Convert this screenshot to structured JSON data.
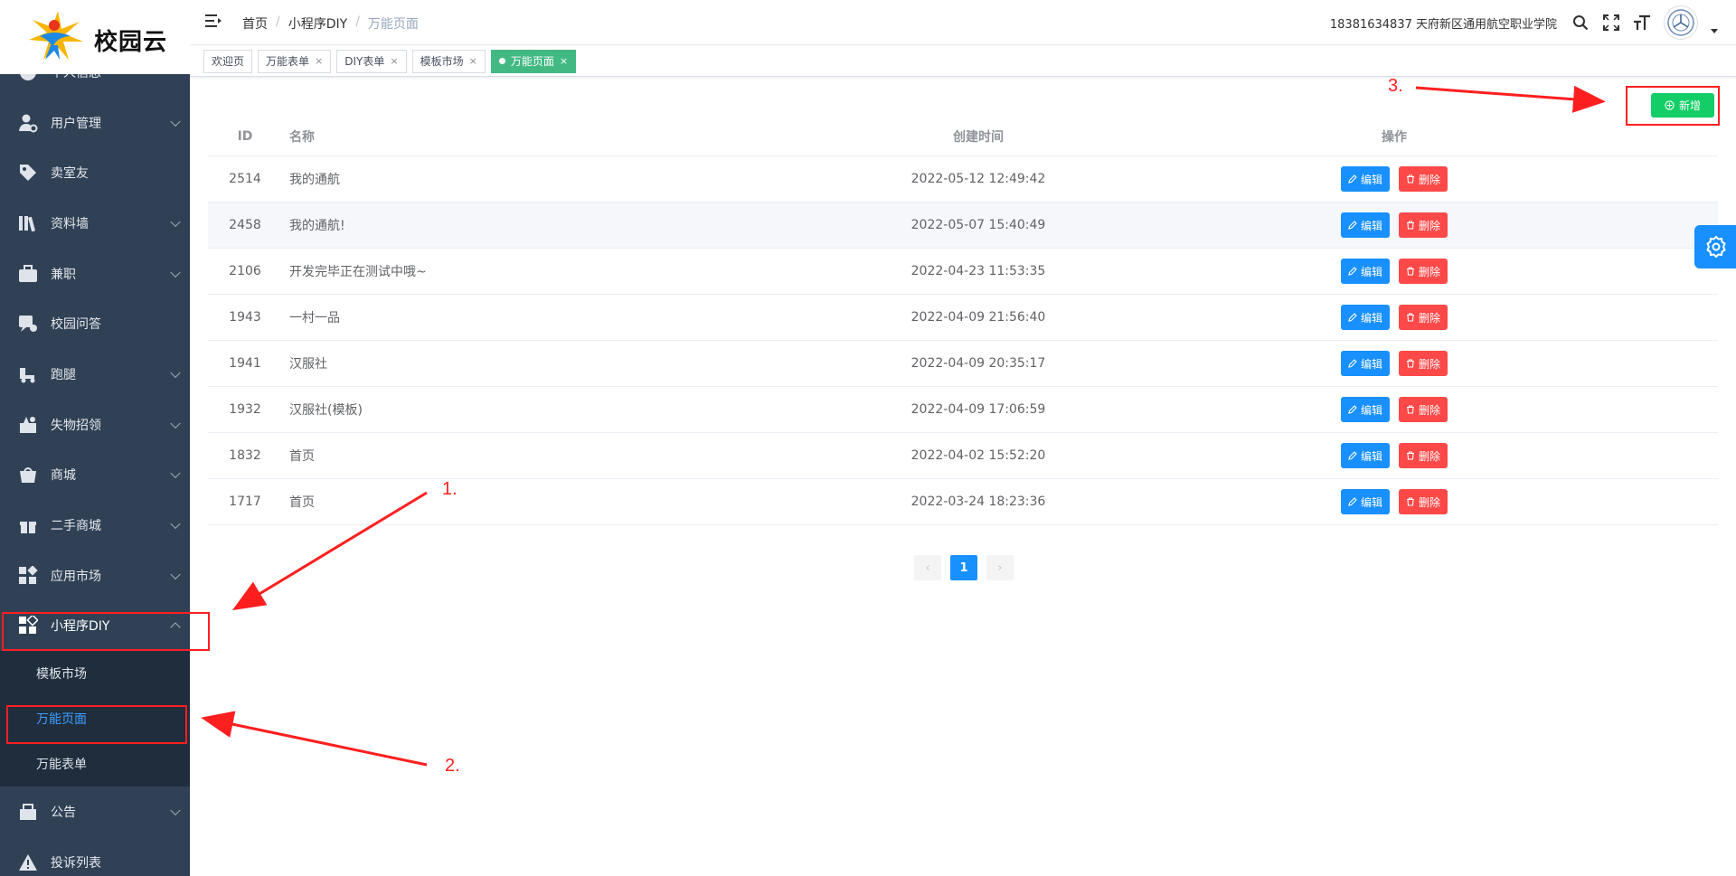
{
  "logo": {
    "text": "校园云"
  },
  "sidebar": {
    "items": [
      {
        "label": "个人信息",
        "icon": "person-circle-icon",
        "has_children": false,
        "partial": true
      },
      {
        "label": "用户管理",
        "icon": "user-gear-icon",
        "has_children": true
      },
      {
        "label": "卖室友",
        "icon": "tag-icon",
        "has_children": false
      },
      {
        "label": "资料墙",
        "icon": "books-icon",
        "has_children": true
      },
      {
        "label": "兼职",
        "icon": "briefcase-icon",
        "has_children": true
      },
      {
        "label": "校园问答",
        "icon": "qa-icon",
        "has_children": false
      },
      {
        "label": "跑腿",
        "icon": "truck-icon",
        "has_children": true
      },
      {
        "label": "失物招领",
        "icon": "lost-found-icon",
        "has_children": true
      },
      {
        "label": "商城",
        "icon": "shop-bag-icon",
        "has_children": true
      },
      {
        "label": "二手商城",
        "icon": "gift-box-icon",
        "has_children": true
      },
      {
        "label": "应用市场",
        "icon": "apps-grid-icon",
        "has_children": true
      },
      {
        "label": "小程序DIY",
        "icon": "diy-grid-icon",
        "has_children": true,
        "expanded": true
      }
    ],
    "submenu": [
      {
        "label": "模板市场"
      },
      {
        "label": "万能页面",
        "active": true
      },
      {
        "label": "万能表单"
      }
    ],
    "after": [
      {
        "label": "公告",
        "icon": "notice-icon",
        "has_children": true
      },
      {
        "label": "投诉列表",
        "icon": "warning-icon",
        "has_children": false,
        "partial": true
      }
    ]
  },
  "header": {
    "breadcrumb": [
      "首页",
      "小程序DIY",
      "万能页面"
    ],
    "user_info": "18381634837 天府新区通用航空职业学院"
  },
  "tags": [
    {
      "label": "欢迎页",
      "closable": false,
      "active": false
    },
    {
      "label": "万能表单",
      "closable": true,
      "active": false
    },
    {
      "label": "DIY表单",
      "closable": true,
      "active": false
    },
    {
      "label": "模板市场",
      "closable": true,
      "active": false
    },
    {
      "label": "万能页面",
      "closable": true,
      "active": true
    }
  ],
  "toolbar": {
    "add_label": "新增"
  },
  "table": {
    "headers": {
      "id": "ID",
      "name": "名称",
      "time": "创建时间",
      "op": "操作"
    },
    "edit_label": "编辑",
    "delete_label": "删除",
    "rows": [
      {
        "id": "2514",
        "name": "我的通航",
        "time": "2022-05-12 12:49:42"
      },
      {
        "id": "2458",
        "name": "我的通航!",
        "time": "2022-05-07 15:40:49"
      },
      {
        "id": "2106",
        "name": "开发完毕正在测试中哦~",
        "time": "2022-04-23 11:53:35"
      },
      {
        "id": "1943",
        "name": "一村一品",
        "time": "2022-04-09 21:56:40"
      },
      {
        "id": "1941",
        "name": "汉服社",
        "time": "2022-04-09 20:35:17"
      },
      {
        "id": "1932",
        "name": "汉服社(模板)",
        "time": "2022-04-09 17:06:59"
      },
      {
        "id": "1832",
        "name": "首页",
        "time": "2022-04-02 15:52:20"
      },
      {
        "id": "1717",
        "name": "首页",
        "time": "2022-03-24 18:23:36"
      }
    ]
  },
  "pagination": {
    "prev": "‹",
    "current": "1",
    "next": "›"
  },
  "annotations": {
    "one": "1.",
    "two": "2.",
    "three": "3."
  },
  "colors": {
    "sidebar_bg": "#304156",
    "primary": "#1890ff",
    "success": "#13ce66",
    "danger": "#ff4949",
    "tag_active": "#42b983",
    "annotation": "#ff1f1f"
  }
}
